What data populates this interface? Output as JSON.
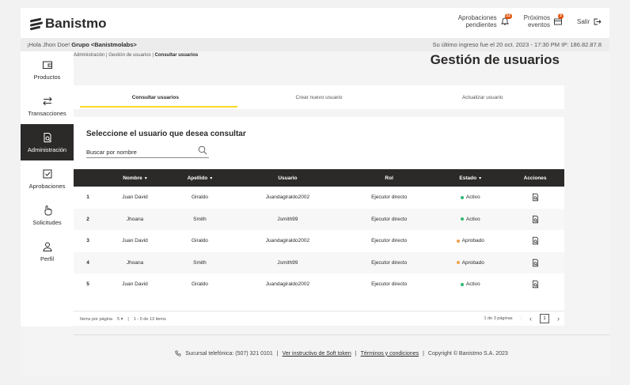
{
  "header": {
    "brand": "Banistmo",
    "approvals_line1": "Aprobaciones",
    "approvals_line2": "pendientes",
    "approvals_badge": "22",
    "events_line1": "Próximos",
    "events_line2": "eventos",
    "events_badge": "3",
    "logout": "Salir"
  },
  "greeting": {
    "hello": "¡Hola Jhon Doe!",
    "group": "Grupo <Banistmolabs>",
    "last_login": "Su último ingreso fue el 20 oct. 2023 - 17:30 PM IP: 186.82.87.8"
  },
  "sidebar": {
    "items": [
      {
        "label": "Productos",
        "icon": "wallet-icon"
      },
      {
        "label": "Transacciones",
        "icon": "transfer-icon"
      },
      {
        "label": "Administración",
        "icon": "document-search-icon"
      },
      {
        "label": "Aprobaciones",
        "icon": "checkbox-icon"
      },
      {
        "label": "Solicitudes",
        "icon": "hand-pointer-icon"
      },
      {
        "label": "Perfil",
        "icon": "user-icon"
      }
    ],
    "active_index": 2
  },
  "breadcrumb": {
    "item1": "Administración",
    "item2": "Gestión de usuarios",
    "item3": "Consultar usuarios"
  },
  "page_title": "Gestión de usuarios",
  "tabs": [
    {
      "label": "Consultar usuarios"
    },
    {
      "label": "Crear nuevo usuario"
    },
    {
      "label": "Actualizar usuario"
    }
  ],
  "card": {
    "title": "Seleccione el usuario que desea consultar",
    "search_placeholder": "Buscar por nombre"
  },
  "table": {
    "columns": {
      "nombre": "Nombre",
      "apellido": "Apellido",
      "usuario": "Usuario",
      "rol": "Rol",
      "estado": "Estado",
      "acciones": "Acciones"
    },
    "rows": [
      {
        "n": "1",
        "nombre": "Juan David",
        "apellido": "Giraldo",
        "usuario": "Juandagiraldo2002",
        "rol": "Ejecutor directo",
        "estado": "Activo"
      },
      {
        "n": "2",
        "nombre": "Jhoana",
        "apellido": "Smith",
        "usuario": "Jsmith99",
        "rol": "Ejecutor directo",
        "estado": "Activo"
      },
      {
        "n": "3",
        "nombre": "Juan David",
        "apellido": "Giraldo",
        "usuario": "Juandagiraldo2002",
        "rol": "Ejecutor directo",
        "estado": "Aprobado"
      },
      {
        "n": "4",
        "nombre": "Jhoana",
        "apellido": "Smith",
        "usuario": "Jsmith99",
        "rol": "Ejecutor directo",
        "estado": "Aprobado"
      },
      {
        "n": "5",
        "nombre": "Juan David",
        "apellido": "Giraldo",
        "usuario": "Juandagiraldo2002",
        "rol": "Ejecutor directo",
        "estado": "Activo"
      }
    ],
    "status_colors": {
      "Activo": "#2eb872",
      "Aprobado": "#f5a04a"
    }
  },
  "pager": {
    "items_label": "Items por página",
    "per_page": "5",
    "range": "1 - 5 de 13 items",
    "pages": "1 de 3 páginas",
    "current": "1"
  },
  "footer": {
    "phone": "Sucursal telefónica: (507) 321 0101",
    "link1": "Ver instructivo de Soft token",
    "link2": "Términos y condiciones",
    "copyright": "Copyright © Banistmo S.A. 2023"
  }
}
